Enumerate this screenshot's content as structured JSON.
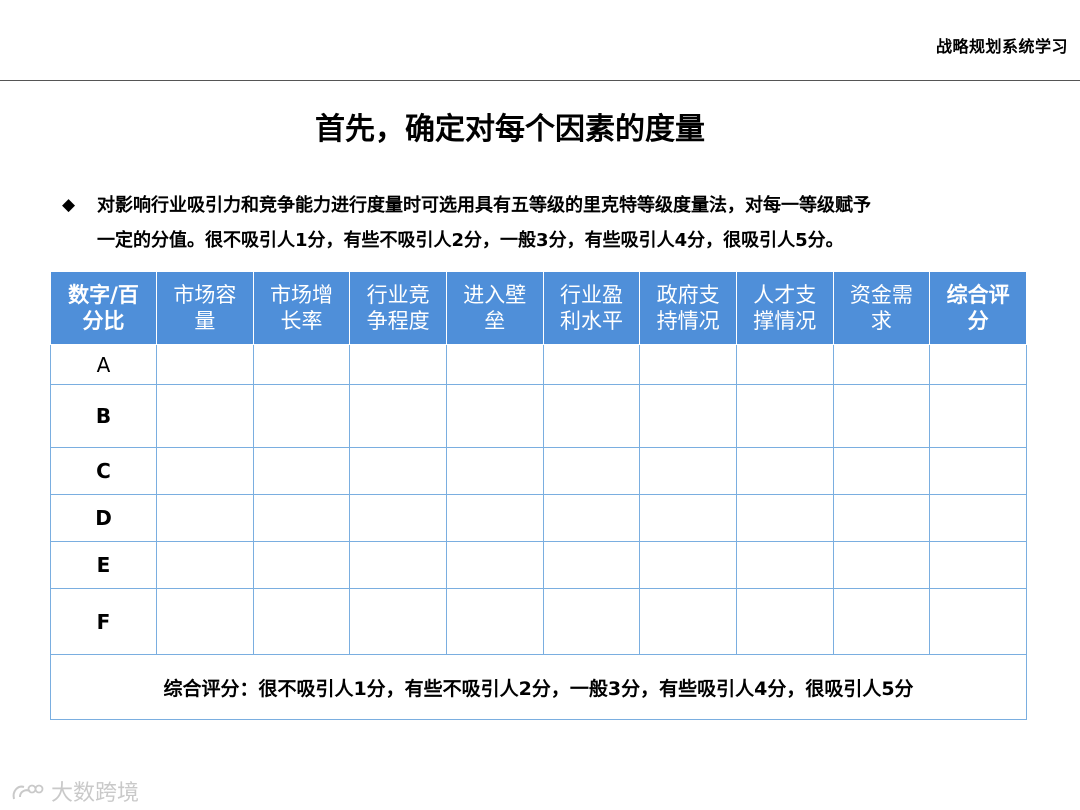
{
  "header": {
    "title": "战略规划系统学习"
  },
  "slide": {
    "title": "首先，确定对每个因素的度量",
    "bullet_marker": "◆",
    "bullet_line1": "对影响行业吸引力和竞争能力进行度量时可选用具有五等级的里克特等级度量法，对每一等级赋予",
    "bullet_line2": "一定的分值。很不吸引人1分，有些不吸引人2分，一般3分，有些吸引人4分，很吸引人5分。"
  },
  "table": {
    "headers": [
      {
        "line1": "数字/百",
        "line2": "分比"
      },
      {
        "line1": "市场容",
        "line2": "量"
      },
      {
        "line1": "市场增",
        "line2": "长率"
      },
      {
        "line1": "行业竞",
        "line2": "争程度"
      },
      {
        "line1": "进入壁",
        "line2": "垒"
      },
      {
        "line1": "行业盈",
        "line2": "利水平"
      },
      {
        "line1": "政府支",
        "line2": "持情况"
      },
      {
        "line1": "人才支",
        "line2": "撑情况"
      },
      {
        "line1": "资金需",
        "line2": "求"
      },
      {
        "line1": "综合评",
        "line2": "分"
      }
    ],
    "rows": [
      "A",
      "B",
      "C",
      "D",
      "E",
      "F"
    ],
    "footer": "综合评分：很不吸引人1分，有些不吸引人2分，一般3分，有些吸引人4分，很吸引人5分"
  },
  "watermark": {
    "text": "大数跨境"
  }
}
